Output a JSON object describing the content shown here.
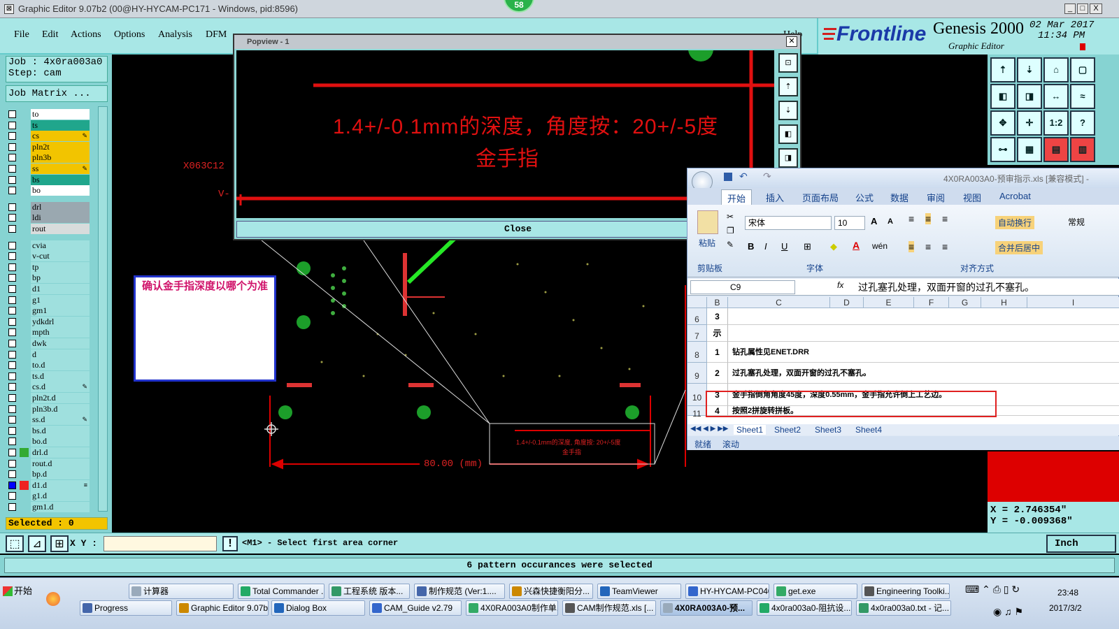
{
  "window": {
    "title": "Graphic Editor 9.07b2 (00@HY-HYCAM-PC171 - Windows, pid:8596)",
    "badge": "58",
    "minimize": "_",
    "maximize": "□",
    "close": "X"
  },
  "menu": {
    "items": [
      "File",
      "Edit",
      "Actions",
      "Options",
      "Analysis",
      "DFM"
    ],
    "help": "Help"
  },
  "brand": {
    "logo": "Frontline",
    "product": "Genesis 2000",
    "subtitle": "Graphic Editor",
    "date": "02 Mar 2017",
    "time": "11:34 PM"
  },
  "job": {
    "job_label": "Job  : 4x0ra003a0",
    "step_label": "Step: cam",
    "matrix_button": "Job Matrix ...",
    "selected": "Selected : 0"
  },
  "layers": [
    {
      "name": "to",
      "color": "#ffffff",
      "mark": ""
    },
    {
      "name": "ts",
      "color": "#20a68c",
      "mark": ""
    },
    {
      "name": "cs",
      "color": "#f2c400",
      "mark": "✎"
    },
    {
      "name": "pln2t",
      "color": "#f2c400",
      "mark": ""
    },
    {
      "name": "pln3b",
      "color": "#f2c400",
      "mark": ""
    },
    {
      "name": "ss",
      "color": "#f2c400",
      "mark": "✎"
    },
    {
      "name": "bs",
      "color": "#20a68c",
      "mark": ""
    },
    {
      "name": "bo",
      "color": "#ffffff",
      "mark": ""
    },
    {
      "name": "drl",
      "color": "#9aa8b0",
      "mark": ""
    },
    {
      "name": "ldi",
      "color": "#9aa8b0",
      "mark": ""
    },
    {
      "name": "rout",
      "color": "#d8dcdc",
      "mark": ""
    },
    {
      "name": "cvia",
      "color": "#9fe0de",
      "mark": ""
    },
    {
      "name": "v-cut",
      "color": "#9fe0de",
      "mark": ""
    },
    {
      "name": "tp",
      "color": "#9fe0de",
      "mark": ""
    },
    {
      "name": "bp",
      "color": "#9fe0de",
      "mark": ""
    },
    {
      "name": "d1",
      "color": "#9fe0de",
      "mark": ""
    },
    {
      "name": "g1",
      "color": "#9fe0de",
      "mark": ""
    },
    {
      "name": "gm1",
      "color": "#9fe0de",
      "mark": ""
    },
    {
      "name": "ydkdrl",
      "color": "#9fe0de",
      "mark": ""
    },
    {
      "name": "mpth",
      "color": "#9fe0de",
      "mark": ""
    },
    {
      "name": "dwk",
      "color": "#9fe0de",
      "mark": ""
    },
    {
      "name": "d",
      "color": "#9fe0de",
      "mark": ""
    },
    {
      "name": "to.d",
      "color": "#9fe0de",
      "mark": ""
    },
    {
      "name": "ts.d",
      "color": "#9fe0de",
      "mark": ""
    },
    {
      "name": "cs.d",
      "color": "#9fe0de",
      "mark": "✎"
    },
    {
      "name": "pln2t.d",
      "color": "#9fe0de",
      "mark": ""
    },
    {
      "name": "pln3b.d",
      "color": "#9fe0de",
      "mark": ""
    },
    {
      "name": "ss.d",
      "color": "#9fe0de",
      "mark": "✎"
    },
    {
      "name": "bs.d",
      "color": "#9fe0de",
      "mark": ""
    },
    {
      "name": "bo.d",
      "color": "#9fe0de",
      "mark": ""
    },
    {
      "name": "drl.d",
      "color": "#9fe0de",
      "mark": ""
    },
    {
      "name": "rout.d",
      "color": "#9fe0de",
      "mark": ""
    },
    {
      "name": "bp.d",
      "color": "#9fe0de",
      "mark": ""
    },
    {
      "name": "d1.d",
      "color": "#9fe0de",
      "mark": "≡"
    },
    {
      "name": "g1.d",
      "color": "#9fe0de",
      "mark": ""
    },
    {
      "name": "gm1.d",
      "color": "#9fe0de",
      "mark": ""
    }
  ],
  "canvas": {
    "side_label": "X063C12",
    "side_label2": "V-",
    "dimension": "80.00 (mm)",
    "note_small": "1.4+/-0.1mm的深度, 角度按: 20+/-5度",
    "note_small2": "金手指",
    "question": "确认金手指深度以哪个为准"
  },
  "popview": {
    "title": "Popview - 1",
    "line1": "1.4+/-0.1mm的深度，角度按：20+/-5度",
    "line2": "金手指",
    "close_label": "Close"
  },
  "excel": {
    "title": "4X0RA003A0-预审指示.xls [兼容模式] -",
    "tabs": [
      "开始",
      "插入",
      "页面布局",
      "公式",
      "数据",
      "审阅",
      "视图",
      "Acrobat"
    ],
    "paste": "粘贴",
    "font_name": "宋体",
    "font_size": "10",
    "wrap": "自动换行",
    "merge": "合并后居中",
    "number_format": "常规",
    "groups": [
      "剪贴板",
      "字体",
      "对齐方式"
    ],
    "cell_ref": "C9",
    "formula": "过孔塞孔处理，双面开窗的过孔不塞孔。",
    "columns": [
      "B",
      "C",
      "D",
      "E",
      "F",
      "G",
      "H",
      "I"
    ],
    "rows": [
      {
        "row": "6",
        "b": "3",
        "c": ""
      },
      {
        "row": "7",
        "b": "示",
        "c": ""
      },
      {
        "row": "8",
        "b": "1",
        "c": "钻孔属性见ENET.DRR"
      },
      {
        "row": "9",
        "b": "2",
        "c": "过孔塞孔处理，双面开窗的过孔不塞孔。"
      },
      {
        "row": "10",
        "b": "3",
        "c": "金手指倒角角度45度，深度0.55mm，金手指允许倒上工艺边。"
      },
      {
        "row": "11",
        "b": "4",
        "c": "按照2拼旋转拼板。"
      }
    ],
    "sheets": [
      "Sheet1",
      "Sheet2",
      "Sheet3",
      "Sheet4"
    ],
    "status": [
      "就绪",
      "滚动"
    ]
  },
  "coords": {
    "x": "X = 2.746354\"",
    "y": "Y = -0.009368\""
  },
  "command": {
    "xy_label": "X Y :",
    "xy_value": "",
    "prompt": "<M1> - Select first area corner",
    "units": "Inch",
    "message": "6 pattern occurances were selected"
  },
  "taskbar": {
    "start": "开始",
    "row1": [
      "计算器",
      "Total Commander ...",
      "工程系统  版本...",
      "制作规范 (Ver:1....",
      "兴森快捷衡阳分...",
      "TeamViewer",
      "HY-HYCAM-PC040...",
      "get.exe",
      "Engineering Toolki..."
    ],
    "row2": [
      "Progress",
      "Graphic Editor 9.07b...",
      "Dialog Box",
      "CAM_Guide v2.79",
      "4X0RA003A0制作单...",
      "CAM制作规范.xls [...",
      "4X0RA003A0-预...",
      "4x0ra003a0-阻抗设...",
      "4x0ra003a0.txt - 记..."
    ],
    "clock_time": "23:48",
    "clock_date": "2017/3/2"
  }
}
